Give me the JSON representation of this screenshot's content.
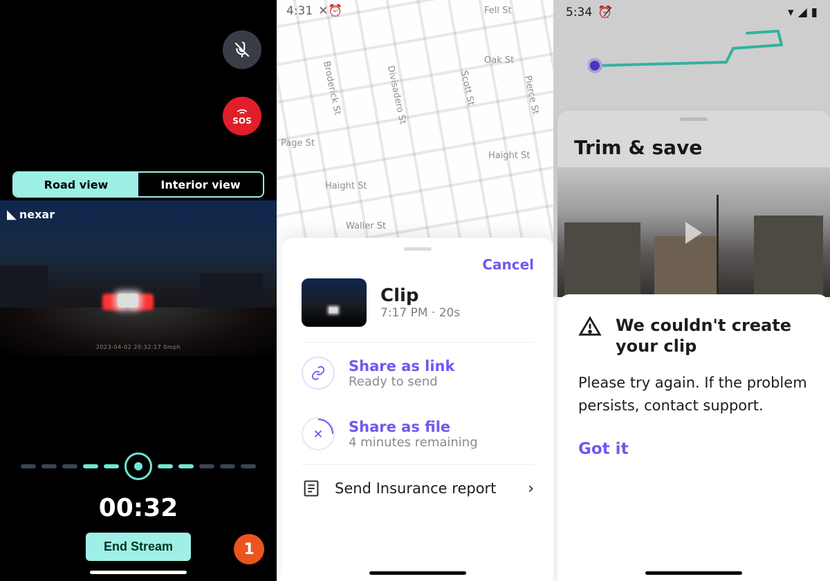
{
  "panel1": {
    "nexar_brand": "nexar",
    "sos_label": "SOS",
    "tabs": {
      "road": "Road view",
      "interior": "Interior view"
    },
    "meta": "2023-04-02  20:32:17      0mph",
    "timer": "00:32",
    "end_stream_label": "End Stream",
    "badge": "1"
  },
  "panel2": {
    "status_time": "4:31",
    "streets": {
      "fell": "Fell St",
      "oak": "Oak St",
      "page": "Page St",
      "haight1": "Haight St",
      "haight2": "Haight St",
      "waller": "Waller St",
      "broderick": "Broderick St",
      "divisadero": "Divisadero St",
      "scott": "Scott St",
      "pierce": "Pierce St"
    },
    "cancel": "Cancel",
    "clip_title": "Clip",
    "clip_sub": "7:17 PM · 20s",
    "share_link_title": "Share as link",
    "share_link_sub": "Ready to send",
    "share_file_title": "Share as file",
    "share_file_sub": "4 minutes remaining",
    "insurance": "Send Insurance report"
  },
  "panel3": {
    "status_time": "5:34",
    "trim_title": "Trim & save",
    "err_title": "We couldn't create your clip",
    "err_body": "Please try again. If the problem persists, contact support.",
    "got_it": "Got it"
  }
}
